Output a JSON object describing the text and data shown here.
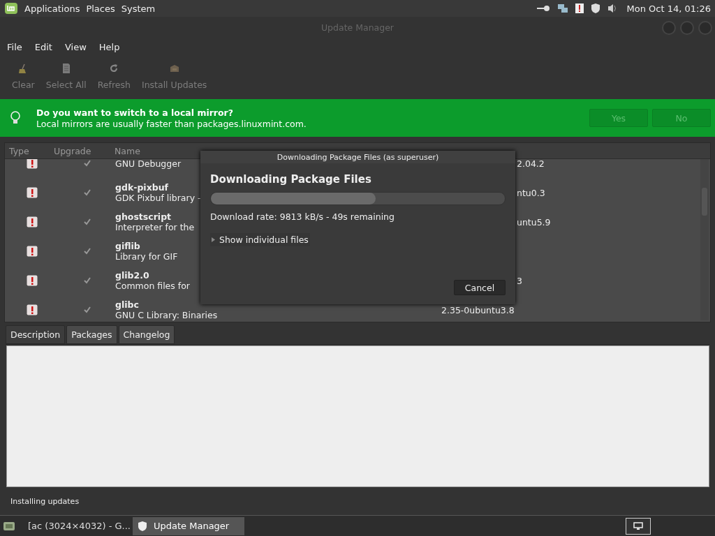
{
  "top_panel": {
    "menus": [
      "Applications",
      "Places",
      "System"
    ],
    "clock": "Mon Oct 14, 01:26"
  },
  "window": {
    "title": "Update Manager"
  },
  "menubar": [
    "File",
    "Edit",
    "View",
    "Help"
  ],
  "toolbar": [
    {
      "kind": "clear",
      "label": "Clear",
      "disabled": true
    },
    {
      "kind": "select",
      "label": "Select All",
      "disabled": true
    },
    {
      "kind": "refresh",
      "label": "Refresh",
      "disabled": true
    },
    {
      "kind": "install",
      "label": "Install Updates",
      "disabled": true
    }
  ],
  "infobar": {
    "title": "Do you want to switch to a local mirror?",
    "text": "Local mirrors are usually faster than packages.linuxmint.com.",
    "buttons": [
      {
        "label": "Yes",
        "disabled": true
      },
      {
        "label": "No",
        "disabled": true
      }
    ]
  },
  "table": {
    "columns": [
      "Type",
      "Upgrade",
      "Name"
    ],
    "rows": [
      {
        "name": "",
        "description": "GNU Debugger",
        "version": "2.04.2",
        "version_covered": true,
        "checked": true
      },
      {
        "name": "gdk-pixbuf",
        "description": "GDK Pixbuf library -",
        "version": "ntu0.3",
        "version_covered": true,
        "checked": true
      },
      {
        "name": "ghostscript",
        "description": "Interpreter for the",
        "version": "untu5.9",
        "version_covered": true,
        "checked": true
      },
      {
        "name": "giflib",
        "description": "Library for GIF",
        "checked": true
      },
      {
        "name": "glib2.0",
        "description": "Common files for",
        "version": "3",
        "version_covered": true,
        "checked": true
      },
      {
        "name": "glibc",
        "description": "GNU C Library: Binaries",
        "version": "2.35-0ubuntu3.8",
        "version_covered": false,
        "checked": true
      }
    ]
  },
  "tabs": [
    {
      "label": "Description",
      "selected": true
    },
    {
      "label": "Packages",
      "selected": false
    },
    {
      "label": "Changelog",
      "selected": false
    }
  ],
  "status_bar": "Installing updates",
  "dialog": {
    "title": "Downloading Package Files (as superuser)",
    "heading": "Downloading Package Files",
    "level": 0.56,
    "rate": "Download rate: 9813 kB/s - 49s remaining",
    "expander": {
      "label": "Show individual files",
      "expanded": false
    },
    "button": "Cancel"
  },
  "taskbar": [
    {
      "kind": "browser",
      "label": "[ac (3024×4032) - G...",
      "selected": false
    },
    {
      "kind": "shield",
      "label": "Update Manager",
      "selected": true
    }
  ]
}
